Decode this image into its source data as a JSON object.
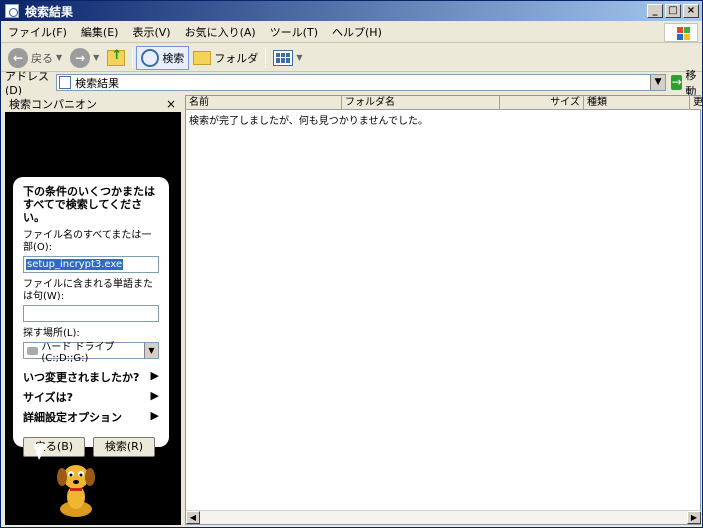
{
  "window": {
    "title": "検索結果"
  },
  "menu": {
    "items": [
      "ファイル(F)",
      "編集(E)",
      "表示(V)",
      "お気に入り(A)",
      "ツール(T)",
      "ヘルプ(H)"
    ]
  },
  "toolbar": {
    "back_label": "戻る",
    "search_label": "検索",
    "folders_label": "フォルダ"
  },
  "address": {
    "label": "アドレス(D)",
    "value": "検索結果",
    "go_label": "移動"
  },
  "companion": {
    "header": "検索コンパニオン",
    "question": "下の条件のいくつかまたはすべてで検索してください。",
    "filename_label": "ファイル名のすべてまたは一部(O):",
    "filename_value": "setup_incrypt3.exe",
    "words_label": "ファイルに含まれる単語または句(W):",
    "words_value": "",
    "location_label": "探す場所(L):",
    "location_value": "ハード ドライブ (C:;D:;G:)",
    "options": [
      "いつ変更されましたか?",
      "サイズは?",
      "詳細設定オプション"
    ],
    "back_button": "戻る(B)",
    "search_button": "検索(R)"
  },
  "results": {
    "columns": [
      "名前",
      "フォルダ名",
      "サイズ",
      "種類",
      "更"
    ],
    "empty_message": "検索が完了しましたが、何も見つかりませんでした。"
  },
  "colors": {
    "title_start": "#0a246a",
    "title_end": "#a6caf0",
    "selection": "#316ac5"
  }
}
